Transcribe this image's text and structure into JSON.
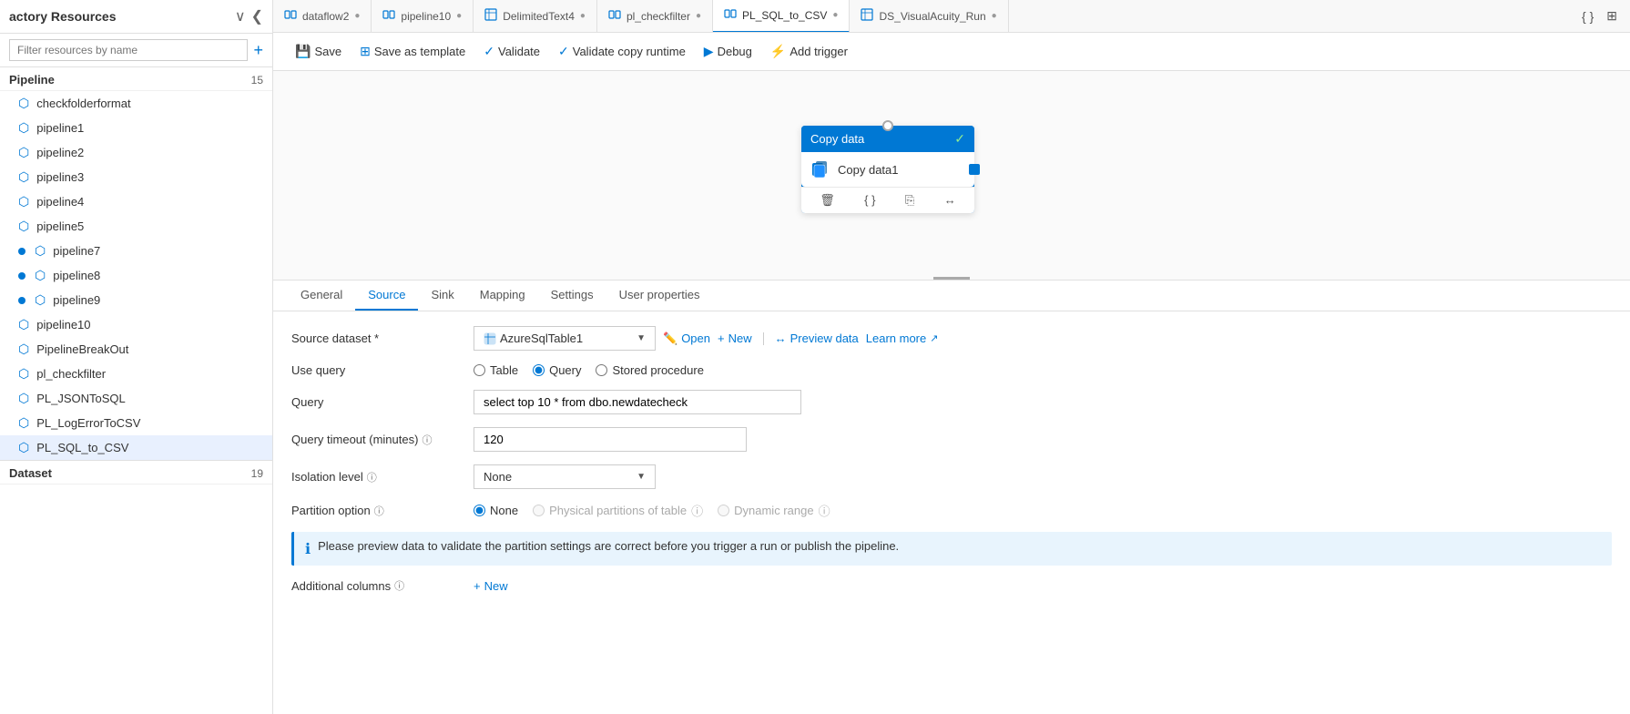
{
  "sidebar": {
    "title": "actory Resources",
    "filter_placeholder": "Filter resources by name",
    "collapse_icon": "❮❮",
    "expand_icon": "❯",
    "add_label": "+",
    "pipeline_section": {
      "label": "Pipeline",
      "count": "15",
      "items": [
        {
          "name": "checkfolderformat",
          "active": false,
          "dot": false
        },
        {
          "name": "pipeline1",
          "active": false,
          "dot": false
        },
        {
          "name": "pipeline2",
          "active": false,
          "dot": false
        },
        {
          "name": "pipeline3",
          "active": false,
          "dot": false
        },
        {
          "name": "pipeline4",
          "active": false,
          "dot": false
        },
        {
          "name": "pipeline5",
          "active": false,
          "dot": false
        },
        {
          "name": "pipeline7",
          "active": false,
          "dot": true
        },
        {
          "name": "pipeline8",
          "active": false,
          "dot": true
        },
        {
          "name": "pipeline9",
          "active": false,
          "dot": true
        },
        {
          "name": "pipeline10",
          "active": false,
          "dot": false
        },
        {
          "name": "PipelineBreakOut",
          "active": false,
          "dot": false
        },
        {
          "name": "pl_checkfilter",
          "active": false,
          "dot": false
        },
        {
          "name": "PL_JSONToSQL",
          "active": false,
          "dot": false
        },
        {
          "name": "PL_LogErrorToCSV",
          "active": false,
          "dot": false
        },
        {
          "name": "PL_SQL_to_CSV",
          "active": true,
          "dot": false
        }
      ]
    },
    "dataset_section": {
      "label": "Dataset",
      "count": "19"
    }
  },
  "tabs": [
    {
      "label": "dataflow2",
      "icon": "⬡",
      "active": false,
      "has_dot": true
    },
    {
      "label": "pipeline10",
      "icon": "⬡",
      "active": false,
      "has_dot": true
    },
    {
      "label": "DelimitedText4",
      "icon": "▦",
      "active": false,
      "has_dot": true
    },
    {
      "label": "pl_checkfilter",
      "icon": "⬡",
      "active": false,
      "has_dot": true
    },
    {
      "label": "PL_SQL_to_CSV",
      "icon": "⬡",
      "active": true,
      "has_dot": true
    },
    {
      "label": "DS_VisualAcuity_Run",
      "icon": "▦",
      "active": false,
      "has_dot": true
    }
  ],
  "toolbar": {
    "save_label": "Save",
    "save_template_label": "Save as template",
    "validate_label": "Validate",
    "validate_copy_label": "Validate copy runtime",
    "debug_label": "Debug",
    "add_trigger_label": "Add trigger"
  },
  "canvas": {
    "node": {
      "title": "Copy data",
      "activity_name": "Copy data1",
      "circle_top": true
    }
  },
  "prop_tabs": [
    {
      "label": "General",
      "active": false
    },
    {
      "label": "Source",
      "active": true
    },
    {
      "label": "Sink",
      "active": false
    },
    {
      "label": "Mapping",
      "active": false
    },
    {
      "label": "Settings",
      "active": false
    },
    {
      "label": "User properties",
      "active": false
    }
  ],
  "source": {
    "dataset_label": "Source dataset *",
    "dataset_value": "AzureSqlTable1",
    "open_label": "Open",
    "new_label": "New",
    "preview_label": "Preview data",
    "learn_more_label": "Learn more",
    "use_query_label": "Use query",
    "query_options": [
      {
        "label": "Table",
        "value": "table",
        "selected": false
      },
      {
        "label": "Query",
        "value": "query",
        "selected": true
      },
      {
        "label": "Stored procedure",
        "value": "stored_procedure",
        "selected": false
      }
    ],
    "query_label": "Query",
    "query_value": "select top 10 * from dbo.newdatecheck",
    "query_timeout_label": "Query timeout (minutes)",
    "query_timeout_info": "ⓘ",
    "query_timeout_value": "120",
    "isolation_level_label": "Isolation level",
    "isolation_level_value": "None",
    "partition_option_label": "Partition option",
    "partition_info": "ⓘ",
    "partition_options": [
      {
        "label": "None",
        "selected": true
      },
      {
        "label": "Physical partitions of table",
        "selected": false
      },
      {
        "label": "Dynamic range",
        "selected": false
      }
    ],
    "info_message": "Please preview data to validate the partition settings are correct before you trigger a run or publish the pipeline.",
    "additional_columns_label": "Additional columns",
    "additional_columns_info": "ⓘ",
    "add_new_label": "New"
  }
}
